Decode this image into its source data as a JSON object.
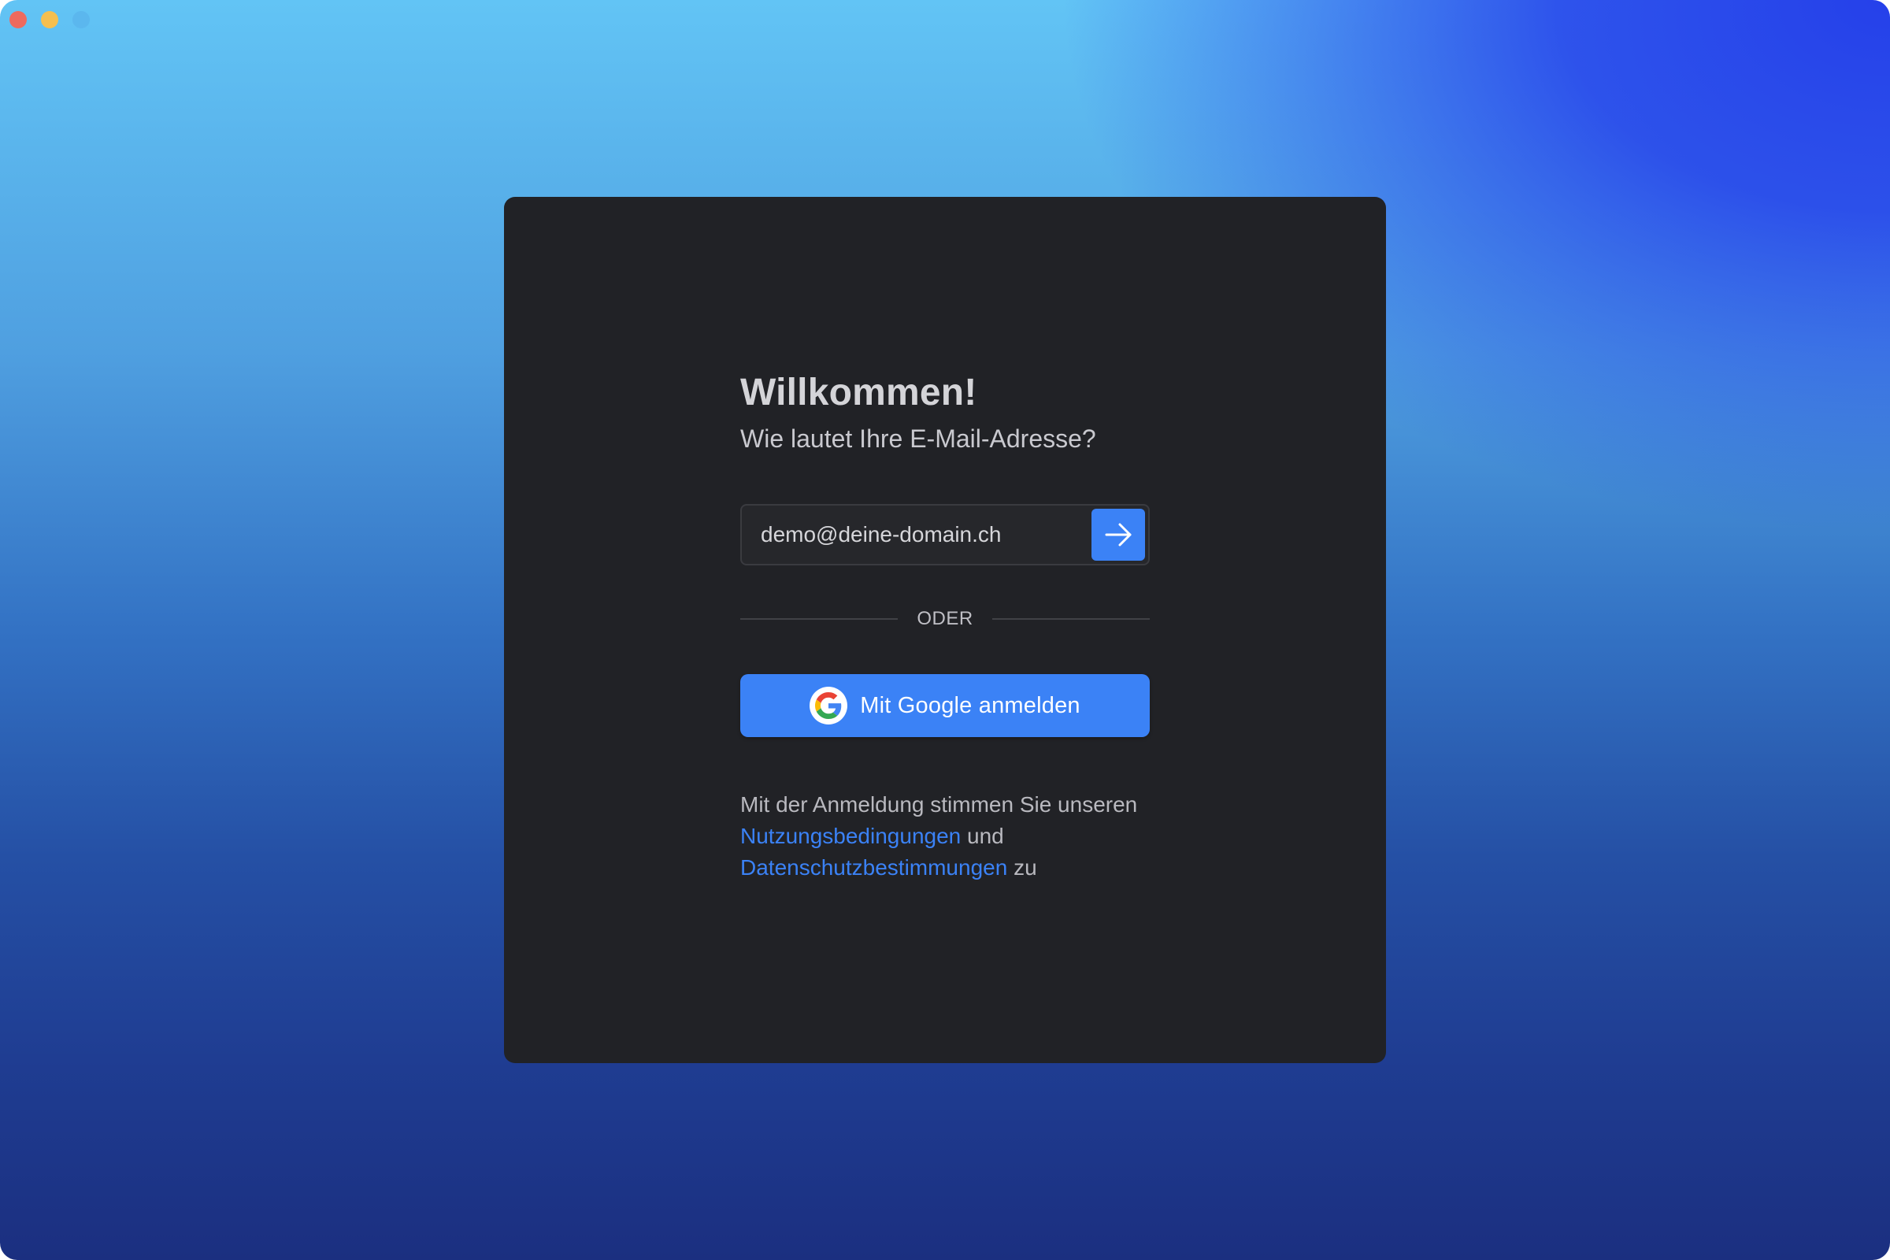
{
  "window": {
    "controls": [
      "close",
      "minimize",
      "zoom"
    ]
  },
  "login": {
    "title": "Willkommen!",
    "subtitle": "Wie lautet Ihre E-Mail-Adresse?",
    "email_value": "demo@deine-domain.ch",
    "submit_icon": "arrow-right-icon",
    "divider_text": "ODER",
    "google_button_label": "Mit Google anmelden",
    "google_icon": "google-icon",
    "terms": {
      "prefix": "Mit der Anmeldung stimmen Sie unseren",
      "terms_link": "Nutzungsbedingungen",
      "conjunction": "und",
      "privacy_link": "Datenschutzbestimmungen",
      "suffix": "zu"
    }
  },
  "colors": {
    "accent": "#3b82f6",
    "card_background": "#212226",
    "close": "#ee6a5e",
    "minimize": "#f5bf4f"
  }
}
